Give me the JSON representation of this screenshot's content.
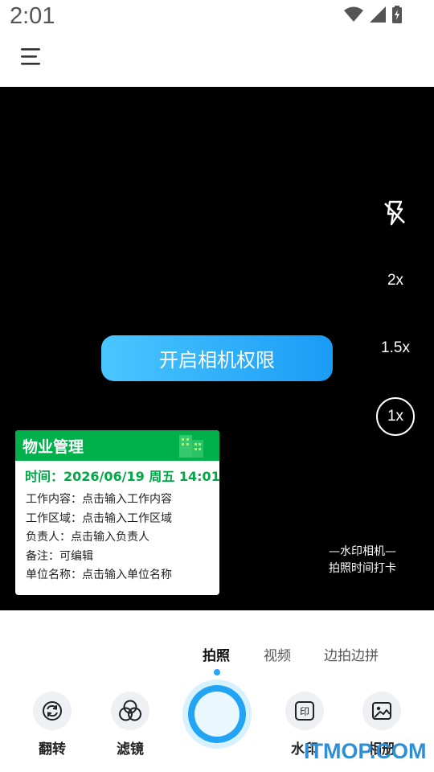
{
  "status_bar": {
    "time": "2:01",
    "icons": [
      "wifi-icon",
      "signal-icon",
      "battery-charging-icon"
    ]
  },
  "header": {
    "menu_icon": "menu-icon"
  },
  "camera": {
    "flash_icon": "flash-off-icon",
    "zoom_options": [
      "2x",
      "1.5x",
      "1x"
    ],
    "selected_zoom": "1x",
    "permission_button": "开启相机权限"
  },
  "watermark": {
    "title": "物业管理",
    "time_text": "时间：2026/06/19 周五 14:01",
    "rows": [
      "工作内容：点击输入工作内容",
      "工作区域：点击输入工作区域",
      "负责人：点击输入负责人",
      "备注：可编辑",
      "单位名称：点击输入单位名称"
    ],
    "accent": "#00b14b"
  },
  "brand": {
    "line1": "—水印相机—",
    "line2": "拍照时间打卡"
  },
  "modes": {
    "items": [
      "拍照",
      "视频",
      "边拍边拼"
    ],
    "active": "拍照"
  },
  "tools": {
    "flip": "翻转",
    "filter": "滤镜",
    "watermark": "水印",
    "album": "相册"
  },
  "site_watermark": "ITMOP.COM",
  "colors": {
    "primary": "#1a9cf5",
    "viewport": "#000000"
  }
}
